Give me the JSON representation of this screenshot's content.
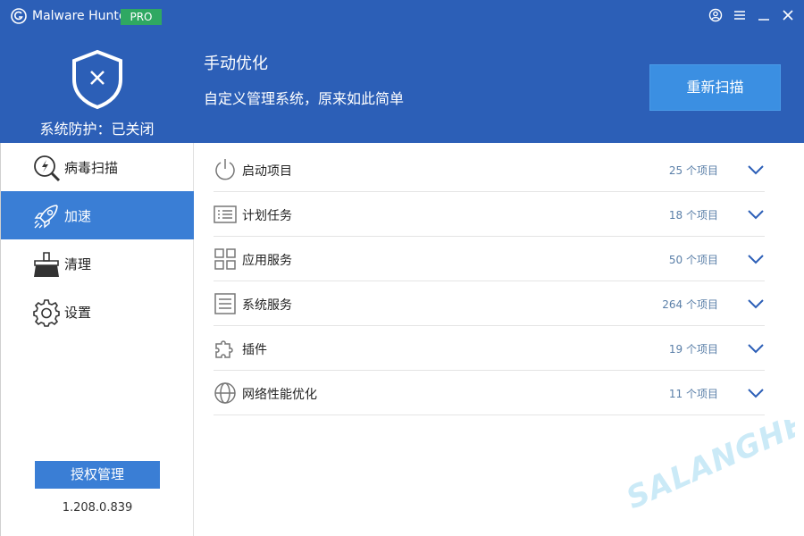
{
  "app": {
    "name": "Malware Hunter",
    "edition": "PRO"
  },
  "header": {
    "protection_status": "系统防护：已关闭",
    "title": "手动优化",
    "subtitle": "自定义管理系统，原来如此简单",
    "rescan_label": "重新扫描"
  },
  "sidebar": {
    "items": [
      {
        "label": "病毒扫描",
        "icon": "virus-scan-icon"
      },
      {
        "label": "加速",
        "icon": "rocket-icon",
        "active": true
      },
      {
        "label": "清理",
        "icon": "broom-icon"
      },
      {
        "label": "设置",
        "icon": "gear-icon"
      }
    ],
    "license_label": "授权管理",
    "version": "1.208.0.839"
  },
  "content": {
    "rows": [
      {
        "label": "启动项目",
        "count": "25 个项目",
        "icon": "power-icon"
      },
      {
        "label": "计划任务",
        "count": "18 个项目",
        "icon": "list-icon"
      },
      {
        "label": "应用服务",
        "count": "50 个项目",
        "icon": "grid-icon"
      },
      {
        "label": "系统服务",
        "count": "264 个项目",
        "icon": "document-icon"
      },
      {
        "label": "插件",
        "count": "19 个项目",
        "icon": "puzzle-icon"
      },
      {
        "label": "网络性能优化",
        "count": "11 个项目",
        "icon": "globe-icon"
      }
    ]
  },
  "watermark": "SALANGHE",
  "colors": {
    "header_bg": "#2c5fb7",
    "accent": "#3a7ed5",
    "rescan_button": "#3b8fe2",
    "pro_badge": "#2fa862"
  }
}
